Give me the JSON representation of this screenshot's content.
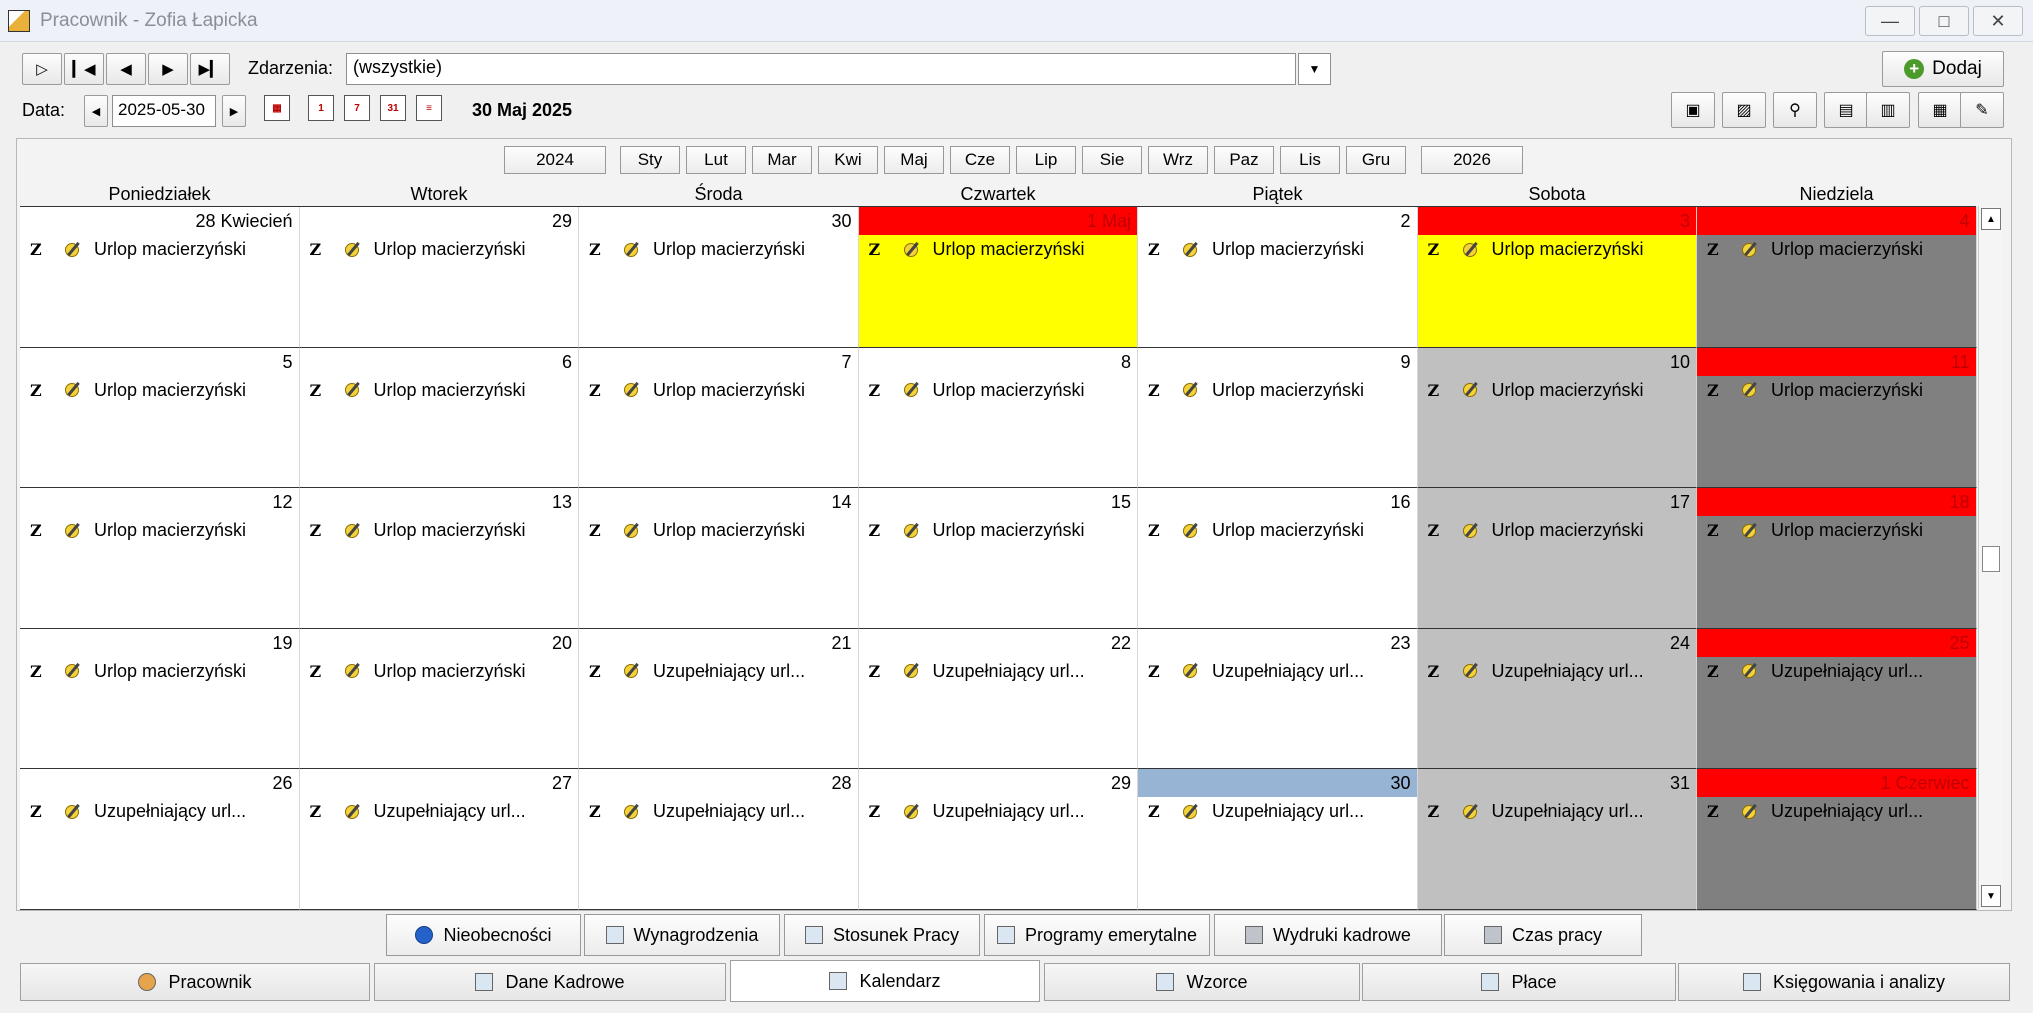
{
  "window": {
    "title": "Pracownik - Zofia Łapicka"
  },
  "toolbar": {
    "events_label": "Zdarzenia:",
    "events_value": "(wszystkie)",
    "add_label": "Dodaj",
    "date_label": "Data:",
    "date_value": "2025-05-30",
    "current_date": "30 Maj 2025"
  },
  "years": {
    "prev": "2024",
    "next": "2026"
  },
  "months": [
    "Sty",
    "Lut",
    "Mar",
    "Kwi",
    "Maj",
    "Cze",
    "Lip",
    "Sie",
    "Wrz",
    "Paz",
    "Lis",
    "Gru"
  ],
  "weekdays": [
    "Poniedziałek",
    "Wtorek",
    "Środa",
    "Czwartek",
    "Piątek",
    "Sobota",
    "Niedziela"
  ],
  "event_code": "Z",
  "colors": {
    "holiday": "#ff0000",
    "special": "#ffff00",
    "saturday": "#c0c0c0",
    "sunday": "#808080",
    "today": "#98b4d4",
    "normal": "#ffffff"
  },
  "weeks": [
    [
      {
        "label": "28 Kwiecień",
        "event": "Urlop macierzyński",
        "type": "normal"
      },
      {
        "label": "29",
        "event": "Urlop macierzyński",
        "type": "normal"
      },
      {
        "label": "30",
        "event": "Urlop macierzyński",
        "type": "normal"
      },
      {
        "label": "1 Maj",
        "event": "Urlop macierzyński",
        "type": "holiday_special"
      },
      {
        "label": "2",
        "event": "Urlop macierzyński",
        "type": "normal"
      },
      {
        "label": "3",
        "event": "Urlop macierzyński",
        "type": "holiday_special"
      },
      {
        "label": "4",
        "event": "Urlop macierzyński",
        "type": "holiday_sunday"
      }
    ],
    [
      {
        "label": "5",
        "event": "Urlop macierzyński",
        "type": "normal"
      },
      {
        "label": "6",
        "event": "Urlop macierzyński",
        "type": "normal"
      },
      {
        "label": "7",
        "event": "Urlop macierzyński",
        "type": "normal"
      },
      {
        "label": "8",
        "event": "Urlop macierzyński",
        "type": "normal"
      },
      {
        "label": "9",
        "event": "Urlop macierzyński",
        "type": "normal"
      },
      {
        "label": "10",
        "event": "Urlop macierzyński",
        "type": "saturday"
      },
      {
        "label": "11",
        "event": "Urlop macierzyński",
        "type": "holiday_sunday"
      }
    ],
    [
      {
        "label": "12",
        "event": "Urlop macierzyński",
        "type": "normal"
      },
      {
        "label": "13",
        "event": "Urlop macierzyński",
        "type": "normal"
      },
      {
        "label": "14",
        "event": "Urlop macierzyński",
        "type": "normal"
      },
      {
        "label": "15",
        "event": "Urlop macierzyński",
        "type": "normal"
      },
      {
        "label": "16",
        "event": "Urlop macierzyński",
        "type": "normal"
      },
      {
        "label": "17",
        "event": "Urlop macierzyński",
        "type": "saturday"
      },
      {
        "label": "18",
        "event": "Urlop macierzyński",
        "type": "holiday_sunday"
      }
    ],
    [
      {
        "label": "19",
        "event": "Urlop macierzyński",
        "type": "normal"
      },
      {
        "label": "20",
        "event": "Urlop macierzyński",
        "type": "normal"
      },
      {
        "label": "21",
        "event": "Uzupełniający url...",
        "type": "normal"
      },
      {
        "label": "22",
        "event": "Uzupełniający url...",
        "type": "normal"
      },
      {
        "label": "23",
        "event": "Uzupełniający url...",
        "type": "normal"
      },
      {
        "label": "24",
        "event": "Uzupełniający url...",
        "type": "saturday"
      },
      {
        "label": "25",
        "event": "Uzupełniający url...",
        "type": "holiday_sunday"
      }
    ],
    [
      {
        "label": "26",
        "event": "Uzupełniający url...",
        "type": "normal"
      },
      {
        "label": "27",
        "event": "Uzupełniający url...",
        "type": "normal"
      },
      {
        "label": "28",
        "event": "Uzupełniający url...",
        "type": "normal"
      },
      {
        "label": "29",
        "event": "Uzupełniający url...",
        "type": "normal"
      },
      {
        "label": "30",
        "event": "Uzupełniający url...",
        "type": "today"
      },
      {
        "label": "31",
        "event": "Uzupełniający url...",
        "type": "saturday"
      },
      {
        "label": "1 Czerwiec",
        "event": "Uzupełniający url...",
        "type": "holiday_sunday"
      }
    ]
  ],
  "sub_tabs": [
    {
      "label": "Nieobecności",
      "icon": "info-icon"
    },
    {
      "label": "Wynagrodzenia",
      "icon": "money-icon"
    },
    {
      "label": "Stosunek Pracy",
      "icon": "contract-icon"
    },
    {
      "label": "Programy emerytalne",
      "icon": "people-icon"
    },
    {
      "label": "Wydruki kadrowe",
      "icon": "printer-icon"
    },
    {
      "label": "Czas pracy",
      "icon": "printer-icon"
    }
  ],
  "main_tabs": [
    {
      "label": "Pracownik",
      "icon": "person-icon"
    },
    {
      "label": "Dane Kadrowe",
      "icon": "card-icon"
    },
    {
      "label": "Kalendarz",
      "icon": "calendar-icon"
    },
    {
      "label": "Wzorce",
      "icon": "people-icon"
    },
    {
      "label": "Płace",
      "icon": "ledger-icon"
    },
    {
      "label": "Księgowania i analizy",
      "icon": "report-icon"
    }
  ],
  "active_main_tab": "Kalendarz"
}
